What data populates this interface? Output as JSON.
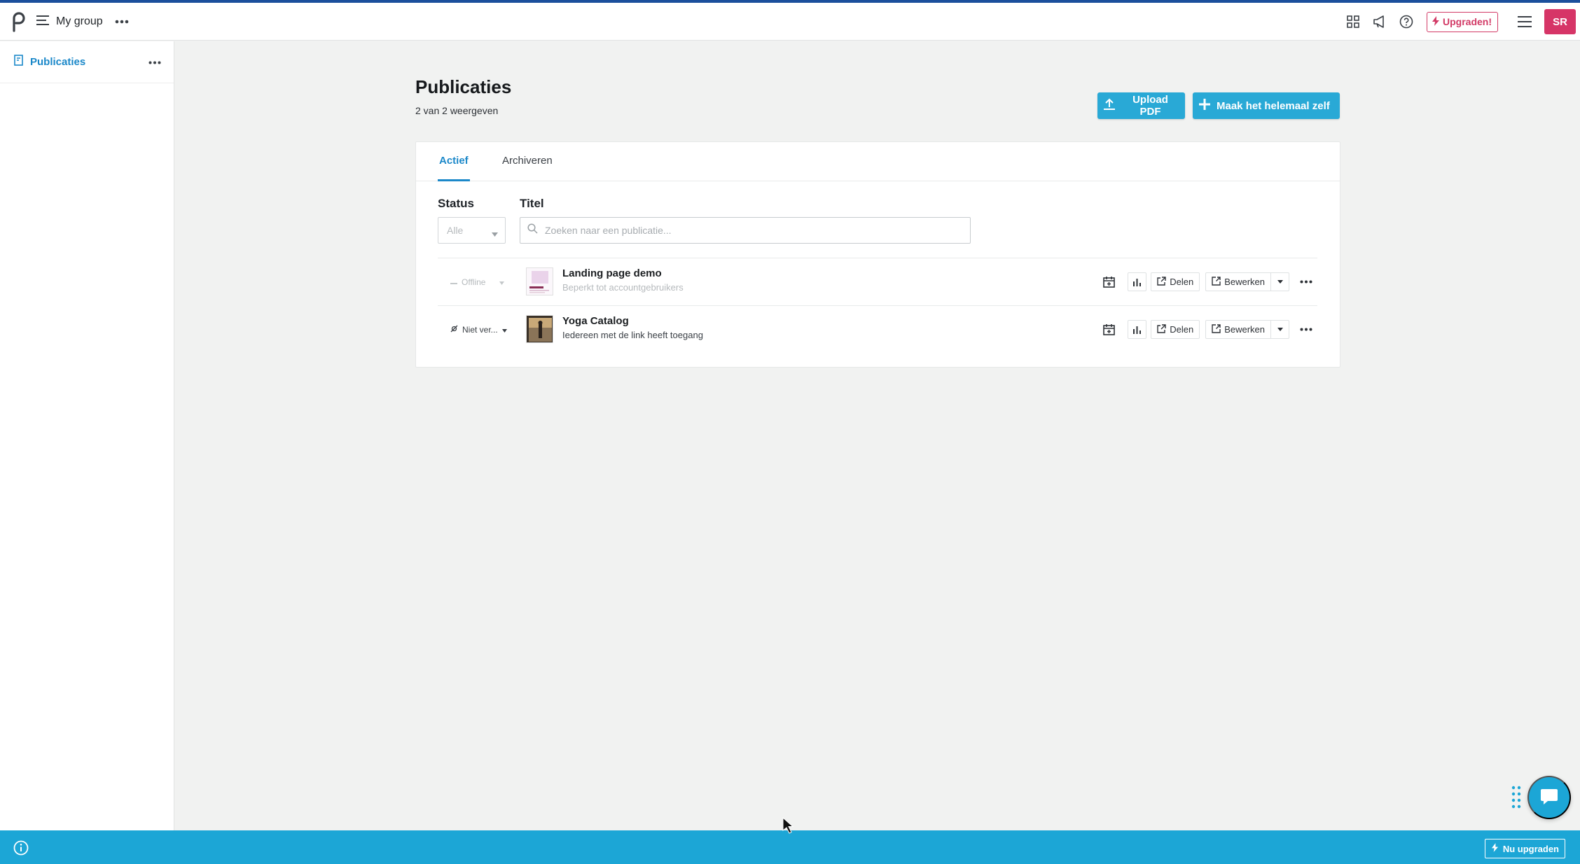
{
  "topbar": {
    "group_name": "My group",
    "upgrade_label": "Upgraden!",
    "avatar_initials": "SR",
    "icons": [
      "apps-grid-icon",
      "megaphone-icon",
      "help-icon",
      "menu-icon"
    ]
  },
  "sidebar": {
    "items": [
      {
        "label": "Publicaties",
        "icon": "publication-icon"
      }
    ]
  },
  "main": {
    "title": "Publicaties",
    "count_text": "2 van 2 weergeven",
    "upload_label": "Upload PDF",
    "make_label": "Maak het helemaal zelf",
    "tabs": [
      {
        "label": "Actief",
        "active": true
      },
      {
        "label": "Archiveren",
        "active": false
      }
    ],
    "filters": {
      "status_label": "Status",
      "status_value": "Alle",
      "title_label": "Titel",
      "search_placeholder": "Zoeken naar een publicatie..."
    },
    "publications": [
      {
        "status": "Offline",
        "title": "Landing page demo",
        "subtitle": "Beperkt tot accountgebruikers",
        "share_label": "Delen",
        "edit_label": "Bewerken"
      },
      {
        "status": "Niet ver...",
        "title": "Yoga Catalog",
        "subtitle": "Iedereen met de link heeft toegang",
        "share_label": "Delen",
        "edit_label": "Bewerken"
      }
    ]
  },
  "bottombar": {
    "upgrade_label": "Nu upgraden"
  },
  "colors": {
    "accent": "#1ca6d6",
    "link": "#1b88c9",
    "brand_pink": "#d63567",
    "page_bg": "#f1f2f1"
  }
}
